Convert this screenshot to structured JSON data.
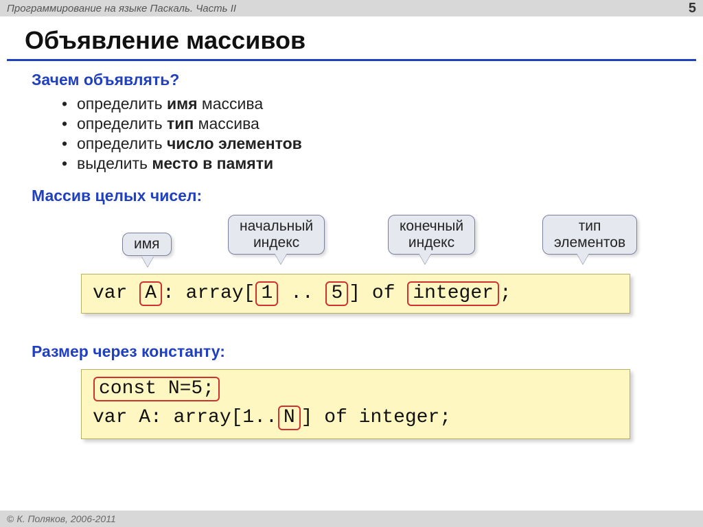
{
  "header": {
    "doc_title": "Программирование на языке Паскаль. Часть II",
    "page_number": "5"
  },
  "title": "Объявление массивов",
  "section_why": {
    "heading": "Зачем объявлять?",
    "bullets": [
      {
        "prefix": "определить ",
        "bold": "имя",
        "suffix": " массива"
      },
      {
        "prefix": "определить ",
        "bold": "тип",
        "suffix": " массива"
      },
      {
        "prefix": "определить ",
        "bold": "число элементов",
        "suffix": ""
      },
      {
        "prefix": "выделить ",
        "bold": "место в памяти",
        "suffix": ""
      }
    ]
  },
  "section_int": {
    "heading": "Массив целых чисел:",
    "callouts": {
      "name": "имя",
      "start_index": "начальный\nиндекс",
      "end_index": "конечный\nиндекс",
      "elem_type": "тип\nэлементов"
    },
    "code": {
      "p1": "var ",
      "hA": "A",
      "p2": ": array[",
      "h1": "1",
      "p3": " .. ",
      "h5": "5",
      "p4": "] of ",
      "hInt": "integer",
      "p5": ";"
    }
  },
  "section_const": {
    "heading": "Размер через константу:",
    "code": {
      "line1_hl": "const N=5;",
      "line2_pre": "var A: array[1..",
      "line2_hl": "N",
      "line2_post": "] of integer;"
    }
  },
  "footer": {
    "copyright": "К. Поляков, 2006-2011"
  }
}
